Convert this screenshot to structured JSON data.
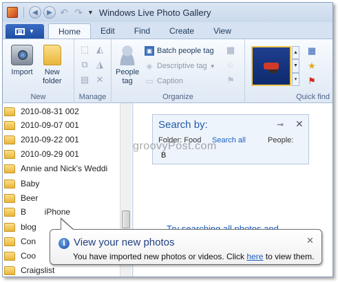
{
  "window": {
    "title": "Windows Live Photo Gallery"
  },
  "ribbon_tabs": [
    "Home",
    "Edit",
    "Find",
    "Create",
    "View"
  ],
  "ribbon": {
    "new_group": {
      "label": "New",
      "import_label": "Import",
      "new_folder_line1": "New",
      "new_folder_line2": "folder"
    },
    "manage_group": {
      "label": "Manage"
    },
    "organize_group": {
      "label": "Organize",
      "people_tag_line1": "People",
      "people_tag_line2": "tag",
      "batch_people_tag": "Batch people tag",
      "descriptive_tag": "Descriptive tag",
      "caption": "Caption"
    },
    "quick_find_group": {
      "label": "Quick find"
    }
  },
  "nav": {
    "items": [
      "2010-08-31 002",
      "2010-09-07 001",
      "2010-09-22 001",
      "2010-09-29 001",
      "Annie and Nick's Weddi",
      "Baby",
      "Beer",
      "B        iPhone",
      "blog",
      "Con",
      "Coo",
      "Craigslist"
    ]
  },
  "search_panel": {
    "title": "Search by:",
    "folder_text": "Folder: Food",
    "search_all": "Search all",
    "people_label": "People:",
    "name_value": "B"
  },
  "watermark": "groovyPost.com",
  "try_link": "Try searching all photos and",
  "balloon": {
    "title": "View your new photos",
    "msg_before": "You have imported new photos or videos.  Click ",
    "msg_link": "here",
    "msg_after": " to view them."
  },
  "colors": {
    "accent": "#1b5fc4",
    "file_button": "#2c5db5"
  }
}
